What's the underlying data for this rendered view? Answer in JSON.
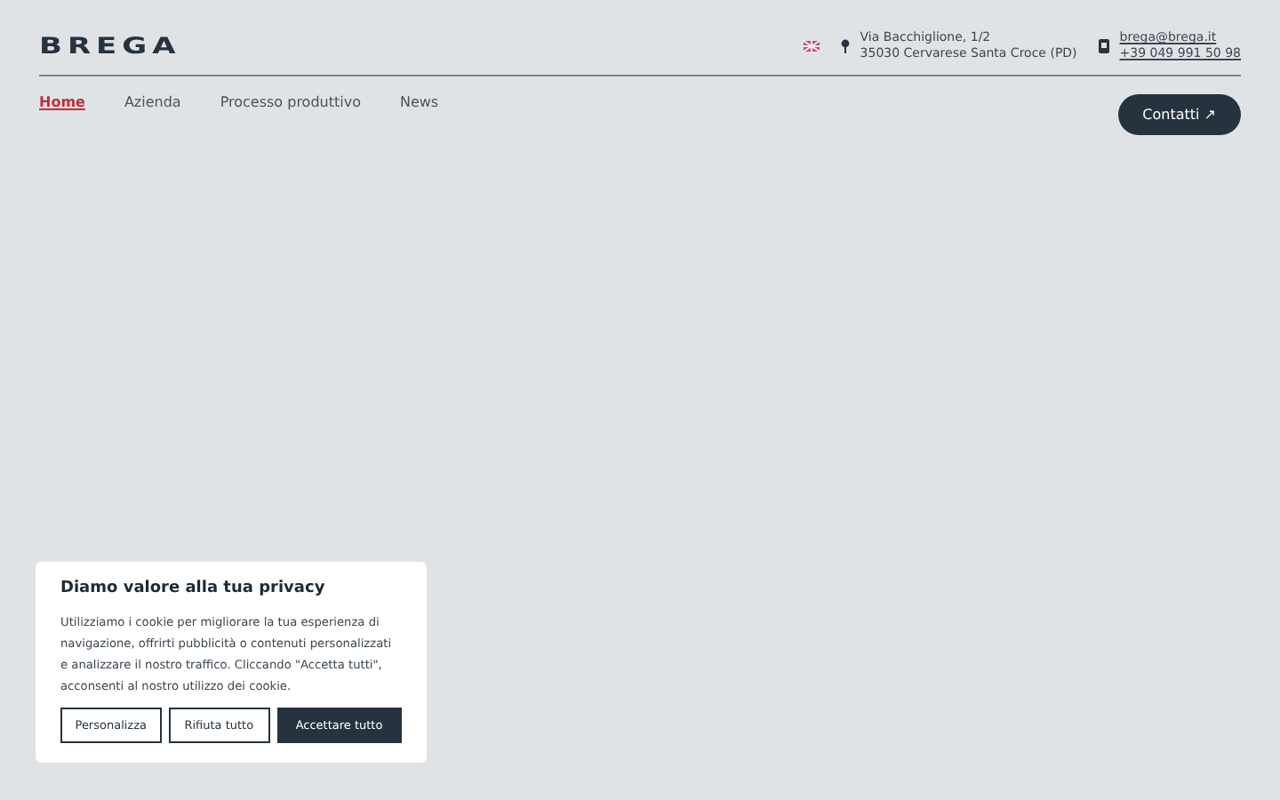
{
  "header": {
    "logo": "BREGA",
    "address": [
      "Via Bacchiglione, 1/2",
      "35030 Cervarese Santa Croce (PD)"
    ],
    "email": "brega@brega.it",
    "phone": "+39 049 991 50 98"
  },
  "nav": [
    {
      "label": "Home",
      "selected": true
    },
    {
      "label": "Azienda",
      "selected": false
    },
    {
      "label": "Processo produttivo",
      "selected": false
    },
    {
      "label": "News",
      "selected": false
    }
  ],
  "contact_button": "Contatti ↗",
  "cookie_banner": {
    "title": "Diamo valore alla tua privacy",
    "text": "Utilizziamo i cookie per migliorare la tua esperienza di navigazione, offrirti pubblicità o contenuti personalizzati e analizzare il nostro traffico. Cliccando \"Accetta tutti\", acconsenti al nostro utilizzo dei cookie.",
    "buttons": [
      {
        "label": "Personalizza",
        "kind": "outline"
      },
      {
        "label": "Rifiuta tutto",
        "kind": "outline"
      },
      {
        "label": "Accettare tutto",
        "kind": "filled"
      }
    ]
  }
}
